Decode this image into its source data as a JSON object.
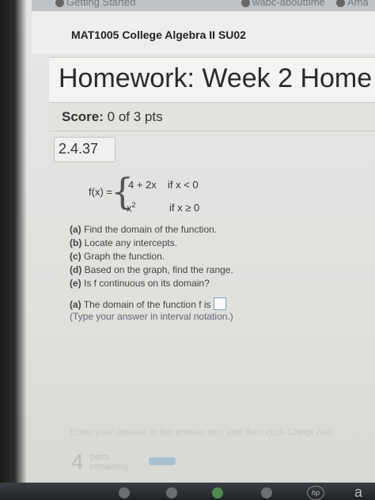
{
  "browser": {
    "bookmarks": [
      {
        "label": "Getting Started",
        "icon": "globe-icon"
      },
      {
        "label": "wabc-abouttime",
        "icon": "globe-icon"
      },
      {
        "label": "Ama",
        "icon": "globe-icon"
      }
    ]
  },
  "course": {
    "title": "MAT1005 College Algebra II SU02"
  },
  "homework": {
    "title": "Homework: Week 2 Home"
  },
  "score": {
    "label": "Score:",
    "value": "0 of 3 pts"
  },
  "question": {
    "number": "2.4.37",
    "function_label": "f(x) =",
    "cases": [
      {
        "expr": "4 + 2x",
        "cond": "if  x < 0"
      },
      {
        "expr_base": "x",
        "expr_exp": "2",
        "cond": "if  x ≥ 0"
      }
    ],
    "parts": [
      {
        "label": "(a)",
        "text": "Find the domain of the function."
      },
      {
        "label": "(b)",
        "text": "Locate any intercepts."
      },
      {
        "label": "(c)",
        "text": "Graph the function."
      },
      {
        "label": "(d)",
        "text": "Based on the graph, find the range."
      },
      {
        "label": "(e)",
        "text": "Is f continuous on its domain?"
      }
    ],
    "answer": {
      "label": "(a)",
      "prompt": "The domain of the function f is",
      "hint": "(Type your answer in interval notation.)"
    }
  },
  "footer": {
    "instruction": "Enter your answer in the answer box and then click Check Ans",
    "parts_remaining_count": "4",
    "parts_remaining_label_1": "parts",
    "parts_remaining_label_2": "remaining"
  },
  "taskbar": {
    "hp_label": "hp",
    "letter": "a"
  }
}
